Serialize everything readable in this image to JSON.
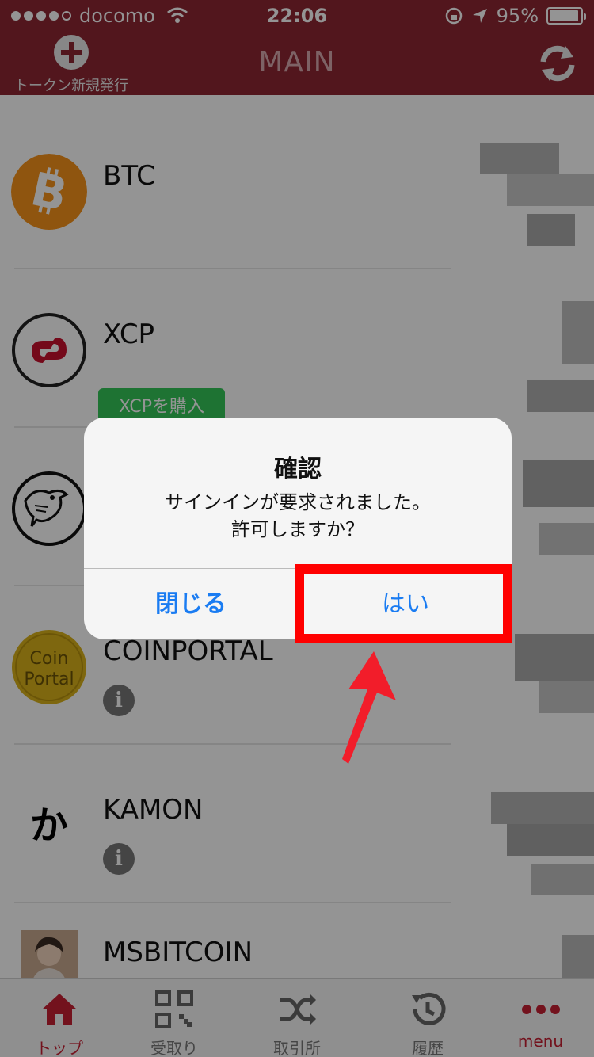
{
  "status": {
    "carrier": "docomo",
    "time": "22:06",
    "battery": "95%",
    "battery_level": 0.95
  },
  "nav": {
    "add_label": "トークン新規発行",
    "title": "MAIN"
  },
  "items": [
    {
      "name": "BTC"
    },
    {
      "name": "XCP",
      "buy_label": "XCPを購入"
    },
    {
      "name": ""
    },
    {
      "name": "COINPORTAL",
      "logo_text_1": "Coin",
      "logo_text_2": "Portal"
    },
    {
      "name": "KAMON",
      "logo_text": "か"
    },
    {
      "name": "MSBITCOIN"
    }
  ],
  "tabs": [
    {
      "label": "トップ"
    },
    {
      "label": "受取り"
    },
    {
      "label": "取引所"
    },
    {
      "label": "履歴"
    },
    {
      "label": "menu"
    }
  ],
  "dialog": {
    "title": "確認",
    "message_line1": "サインインが要求されました。",
    "message_line2": "許可しますか？",
    "close_label": "閉じる",
    "yes_label": "はい"
  },
  "colors": {
    "nav_bg": "#8e2733",
    "accent_blue": "#1a7cf2",
    "highlight_red": "#ff0000",
    "buy_green": "#34c659"
  }
}
